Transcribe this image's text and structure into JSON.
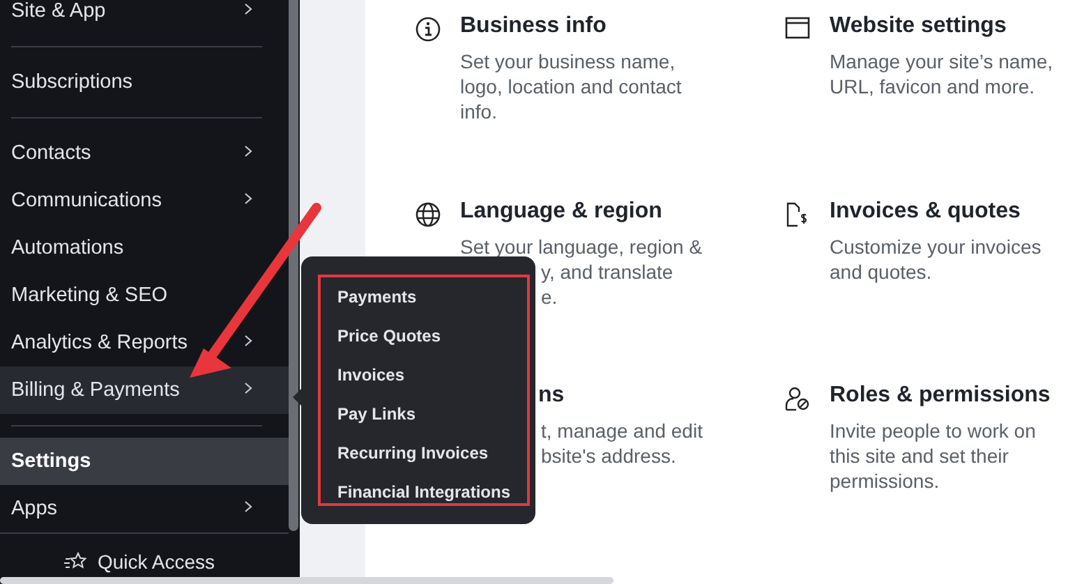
{
  "sidebar": {
    "sections": [
      {
        "items": [
          {
            "label": "Site & App",
            "has_submenu": true,
            "selected": false,
            "hovered": false
          }
        ]
      },
      {
        "items": [
          {
            "label": "Subscriptions",
            "has_submenu": false,
            "selected": false,
            "hovered": false
          }
        ]
      },
      {
        "items": [
          {
            "label": "Contacts",
            "has_submenu": true,
            "selected": false,
            "hovered": false
          },
          {
            "label": "Communications",
            "has_submenu": true,
            "selected": false,
            "hovered": false
          },
          {
            "label": "Automations",
            "has_submenu": false,
            "selected": false,
            "hovered": false
          },
          {
            "label": "Marketing & SEO",
            "has_submenu": false,
            "selected": false,
            "hovered": false
          },
          {
            "label": "Analytics & Reports",
            "has_submenu": true,
            "selected": false,
            "hovered": false
          },
          {
            "label": "Billing & Payments",
            "has_submenu": true,
            "selected": false,
            "hovered": true
          }
        ]
      },
      {
        "items": [
          {
            "label": "Settings",
            "has_submenu": false,
            "selected": true,
            "hovered": false
          },
          {
            "label": "Apps",
            "has_submenu": true,
            "selected": false,
            "hovered": false
          }
        ]
      }
    ],
    "quick_access": "Quick Access"
  },
  "submenu": {
    "highlighted": true,
    "items": [
      "Payments",
      "Price Quotes",
      "Invoices",
      "Pay Links",
      "Recurring Invoices",
      "Financial Integrations"
    ]
  },
  "cards": [
    {
      "title": {
        "text": "Business info",
        "covered": false
      },
      "lines": [
        {
          "text": "Set your business name,",
          "covered": false
        },
        {
          "text": "logo, location and contact",
          "covered": false
        },
        {
          "text": "info.",
          "covered": false
        }
      ]
    },
    {
      "title": {
        "text": "Website settings",
        "covered": false
      },
      "lines": [
        {
          "text": "Manage your site’s name,",
          "covered": false
        },
        {
          "text": "URL, favicon and more.",
          "covered": false
        }
      ]
    },
    {
      "title": {
        "text": "Language & region",
        "covered": false
      },
      "lines": [
        {
          "text": "Set your language, region &",
          "covered": false
        },
        {
          "text": "y, and translate",
          "covered": true
        },
        {
          "text": "e.",
          "covered": true
        }
      ]
    },
    {
      "title": {
        "text": "Invoices & quotes",
        "covered": false
      },
      "lines": [
        {
          "text": "Customize your invoices",
          "covered": false
        },
        {
          "text": "and quotes.",
          "covered": false
        }
      ]
    },
    {
      "title": {
        "text": "ns",
        "covered": true
      },
      "lines": [
        {
          "text": "t, manage and edit",
          "covered": true
        },
        {
          "text": "bsite's address.",
          "covered": true
        }
      ]
    },
    {
      "title": {
        "text": "Roles & permissions",
        "covered": false
      },
      "lines": [
        {
          "text": "Invite people to work on",
          "covered": false
        },
        {
          "text": "this site and set their",
          "covered": false
        },
        {
          "text": "permissions.",
          "covered": false
        }
      ]
    }
  ]
}
